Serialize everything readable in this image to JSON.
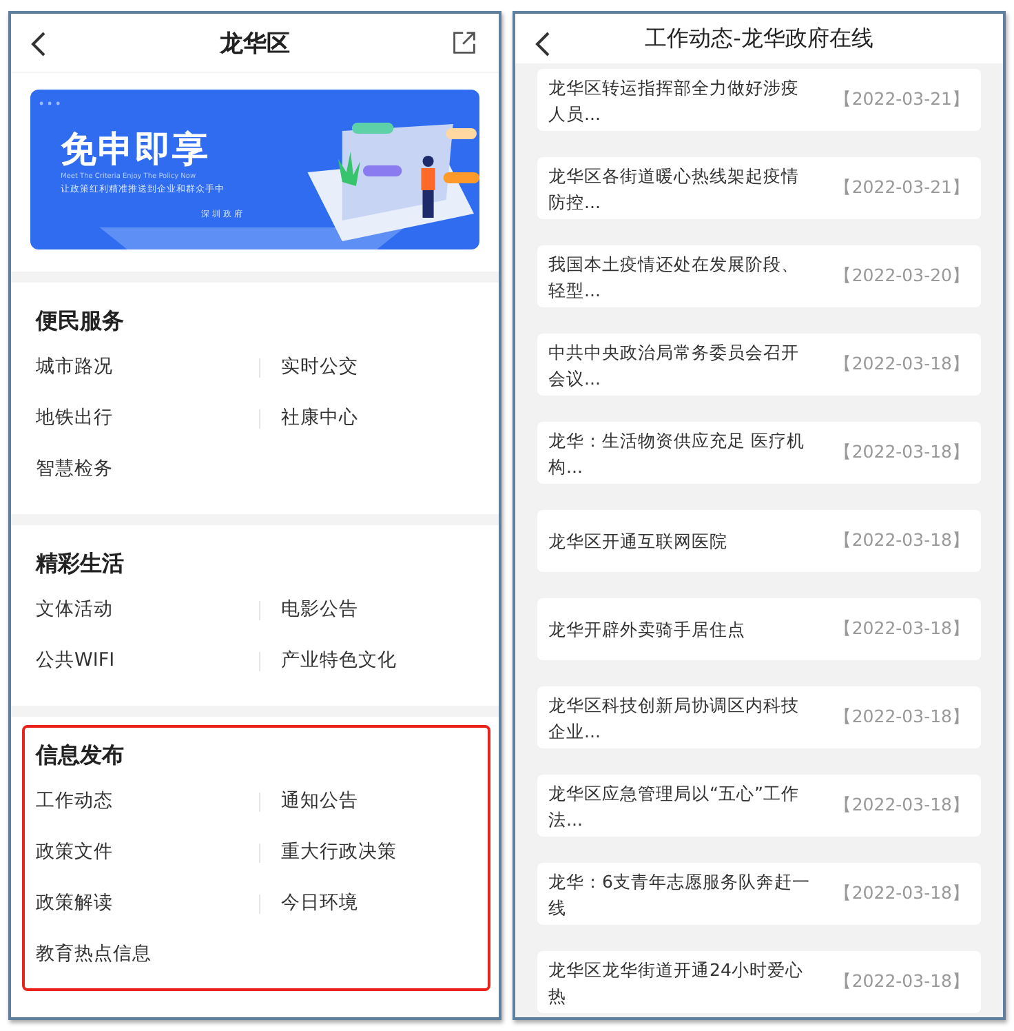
{
  "left_screen": {
    "title": "龙华区",
    "banner": {
      "headline": "免申即享",
      "tagline_en": "Meet The Criteria Enjoy The Policy Now",
      "tagline": "让政策红利精准推送到企业和群众手中",
      "signature": "深圳政府"
    },
    "sections": [
      {
        "title": "便民服务",
        "highlighted": false,
        "items": [
          "城市路况",
          "实时公交",
          "地铁出行",
          "社康中心",
          "智慧检务"
        ]
      },
      {
        "title": "精彩生活",
        "highlighted": false,
        "items": [
          "文体活动",
          "电影公告",
          "公共WIFI",
          "产业特色文化"
        ]
      },
      {
        "title": "信息发布",
        "highlighted": true,
        "items": [
          "工作动态",
          "通知公告",
          "政策文件",
          "重大行政决策",
          "政策解读",
          "今日环境",
          "教育热点信息"
        ]
      }
    ]
  },
  "right_screen": {
    "title": "工作动态-龙华政府在线",
    "news": [
      {
        "title_lines": [
          "龙华区转运指挥部全力做好涉疫",
          "人员..."
        ],
        "date": "【2022-03-21】"
      },
      {
        "title_lines": [
          "龙华区各街道暖心热线架起疫情",
          "防控..."
        ],
        "date": "【2022-03-21】"
      },
      {
        "title_lines": [
          "我国本土疫情还处在发展阶段、",
          "轻型..."
        ],
        "date": "【2022-03-20】"
      },
      {
        "title_lines": [
          "中共中央政治局常务委员会召开",
          "会议..."
        ],
        "date": "【2022-03-18】"
      },
      {
        "title_lines": [
          "龙华：生活物资供应充足 医疗机",
          "构..."
        ],
        "date": "【2022-03-18】"
      },
      {
        "title_lines": [
          "龙华区开通互联网医院"
        ],
        "date": "【2022-03-18】"
      },
      {
        "title_lines": [
          "龙华开辟外卖骑手居住点"
        ],
        "date": "【2022-03-18】"
      },
      {
        "title_lines": [
          "龙华区科技创新局协调区内科技",
          "企业..."
        ],
        "date": "【2022-03-18】"
      },
      {
        "title_lines": [
          "龙华区应急管理局以“五心”工作",
          "法..."
        ],
        "date": "【2022-03-18】"
      },
      {
        "title_lines": [
          "龙华：6支青年志愿服务队奔赶一",
          "线"
        ],
        "date": "【2022-03-18】"
      },
      {
        "title_lines": [
          "龙华区龙华街道开通24小时爱心",
          "热"
        ],
        "date": "【2022-03-18】"
      }
    ]
  }
}
